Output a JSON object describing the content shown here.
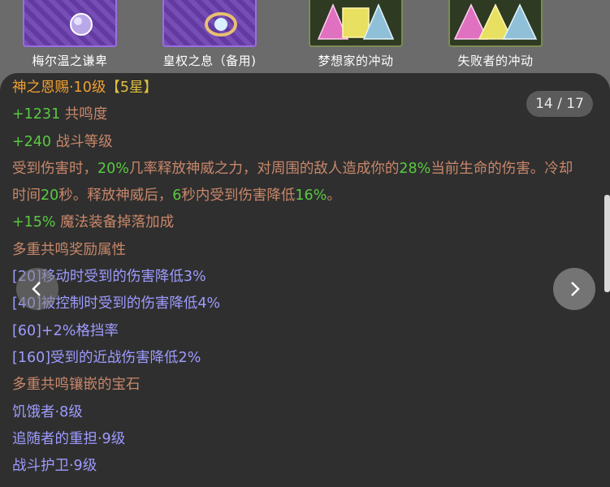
{
  "gems": [
    {
      "label": "梅尔温之谦卑",
      "icon": "orb-gem-icon",
      "style": "purple"
    },
    {
      "label": "皇权之息（备用)",
      "icon": "ring-gem-icon",
      "style": "purple"
    },
    {
      "label": "梦想家的冲动",
      "icon": "tri-gem-icon",
      "style": "dark"
    },
    {
      "label": "失败者的冲动",
      "icon": "tri-gem-icon",
      "style": "dark"
    }
  ],
  "counter": "14 / 17",
  "tooltip": {
    "title_name": "神之恩赐·10级",
    "title_star": "【5星】",
    "stat1_value": "+1231",
    "stat1_label": " 共鸣度",
    "stat2_value": "+240",
    "stat2_label": " 战斗等级",
    "effect": {
      "p1": "受到伤害时，",
      "v1": "20%",
      "p2": "几率释放神威之力，对周围的敌人造成你的",
      "v2": "28%",
      "p3": "当前生命的伤害。冷却时间",
      "v3": "20",
      "p4": "秒。释放神威后，",
      "v4": "6",
      "p5": "秒内受到伤害降低",
      "v5": "16%",
      "p6": "。"
    },
    "stat3_value": "+15%",
    "stat3_label": " 魔法装备掉落加成",
    "bonus_header": "多重共鸣奖励属性",
    "bonuses": [
      "[20]移动时受到的伤害降低3%",
      "[40]被控制时受到的伤害降低4%",
      "[60]+2%格挡率",
      "[160]受到的近战伤害降低2%"
    ],
    "socket_header": "多重共鸣镶嵌的宝石",
    "sockets": [
      "饥饿者·8级",
      "追随者的重担·9级",
      "战斗护卫·9级"
    ]
  },
  "colors": {
    "title": "#f0a030",
    "star": "#e0c040",
    "value_green": "#59c940",
    "label_brown": "#c9876a",
    "bonus_blue": "#9e9bff"
  },
  "nav": {
    "prev_icon": "chevron-left-icon",
    "next_icon": "chevron-right-icon"
  }
}
